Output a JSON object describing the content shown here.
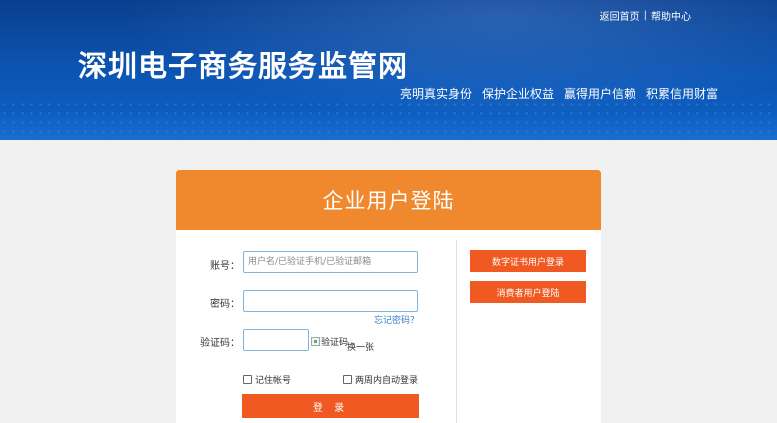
{
  "header": {
    "top_links": {
      "home": "返回首页",
      "separator": "|",
      "help": "帮助中心"
    },
    "site_title": "深圳电子商务服务监管网",
    "slogans": [
      "亮明真实身份",
      "保护企业权益",
      "赢得用户信赖",
      "积累信用财富"
    ]
  },
  "login": {
    "title": "企业用户登陆",
    "account_label": "账号：",
    "account_placeholder": "用户名/已验证手机/已验证邮箱",
    "password_label": "密码：",
    "forgot_password": "忘记密码？",
    "captcha_label": "验证码：",
    "captcha_alt": "验证码",
    "refresh_captcha": "换一张",
    "remember_account": "记住帐号",
    "auto_login": "两周内自动登录",
    "submit": "登 录"
  },
  "side_actions": {
    "cert_login": "数字证书用户登录",
    "consumer_login": "消费者用户登陆"
  },
  "colors": {
    "banner": "#0c56b5",
    "header_orange": "#f0892e",
    "button_orange": "#f05a22",
    "link_blue": "#3a7fc6"
  }
}
